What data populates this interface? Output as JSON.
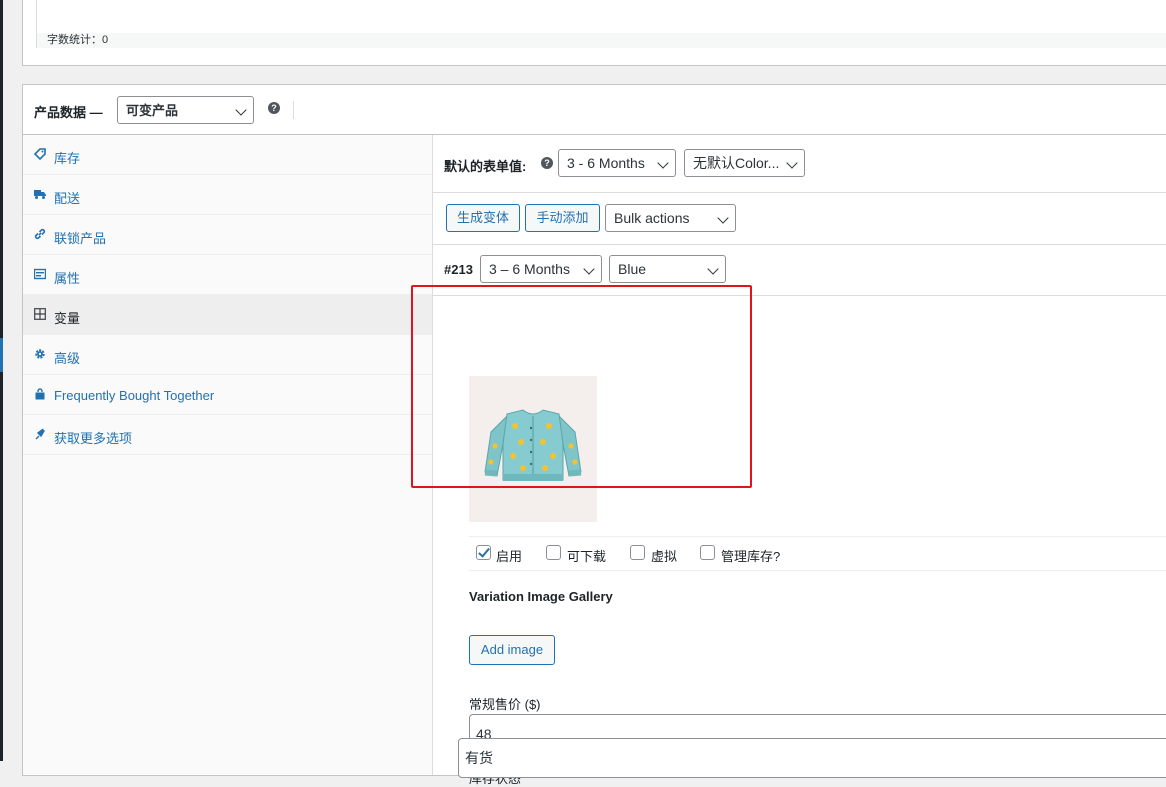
{
  "word_count": "字数统计：0",
  "product_data": {
    "title": "产品数据 —",
    "type_select": "可变产品",
    "help": "?"
  },
  "tabs": [
    {
      "label": "库存",
      "icon": "tag-icon"
    },
    {
      "label": "配送",
      "icon": "truck-icon"
    },
    {
      "label": "联锁产品",
      "icon": "link-icon"
    },
    {
      "label": "属性",
      "icon": "list-icon"
    },
    {
      "label": "变量",
      "icon": "grid-icon",
      "active": true
    },
    {
      "label": "高级",
      "icon": "gear-icon"
    },
    {
      "label": "Frequently Bought Together",
      "icon": "bag-icon"
    },
    {
      "label": "获取更多选项",
      "icon": "plugin-icon"
    }
  ],
  "defaults": {
    "label": "默认的表单值:",
    "size_select": "3 - 6 Months",
    "color_select": "无默认Color..."
  },
  "actions": {
    "generate": "生成变体",
    "manual_add": "手动添加",
    "bulk_select": "Bulk actions"
  },
  "variation": {
    "id": "#213",
    "size_select": "3 – 6 Months",
    "color_select": "Blue",
    "options": [
      {
        "label": "启用",
        "checked": true
      },
      {
        "label": "可下载",
        "checked": false
      },
      {
        "label": "虚拟",
        "checked": false
      },
      {
        "label": "管理库存?",
        "checked": false
      }
    ],
    "gallery_title": "Variation Image Gallery",
    "add_image": "Add image",
    "price_label": "常规售价 ($)",
    "price_value": "48",
    "stock_label": "库存状态",
    "stock_value": "有货"
  },
  "colors": {
    "accent": "#2271b1",
    "highlight": "#e0151c",
    "sweater": "#7fc4c8",
    "duck": "#f2c230"
  }
}
